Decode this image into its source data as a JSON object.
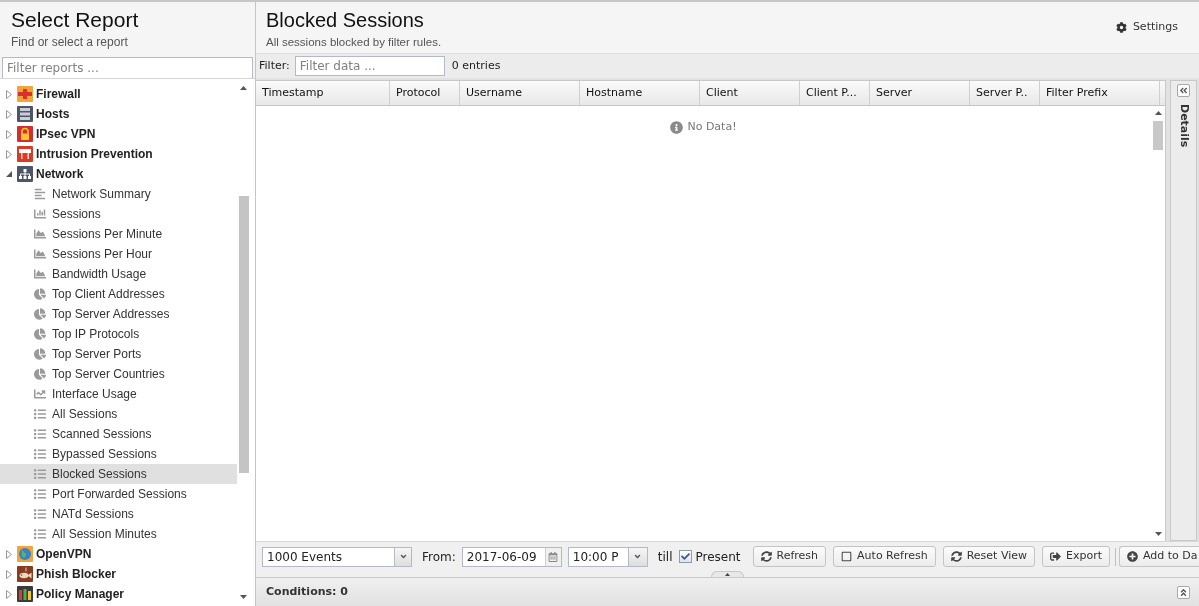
{
  "sidebar": {
    "title": "Select Report",
    "subtitle": "Find or select a report",
    "filter": {
      "placeholder": "Filter reports ..."
    },
    "tree": [
      {
        "label": "Firewall",
        "kind": "firewall",
        "expanded": false,
        "selected": false
      },
      {
        "label": "Hosts",
        "kind": "hosts",
        "expanded": false,
        "selected": false
      },
      {
        "label": "IPsec VPN",
        "kind": "ipsec",
        "expanded": false,
        "selected": false
      },
      {
        "label": "Intrusion Prevention",
        "kind": "ips",
        "expanded": false,
        "selected": false
      },
      {
        "label": "Network",
        "kind": "network",
        "expanded": true,
        "selected": false,
        "children": [
          {
            "label": "Network Summary",
            "kind": "summary",
            "selected": false
          },
          {
            "label": "Sessions",
            "kind": "bar",
            "selected": false
          },
          {
            "label": "Sessions Per Minute",
            "kind": "area",
            "selected": false
          },
          {
            "label": "Sessions Per Hour",
            "kind": "area",
            "selected": false
          },
          {
            "label": "Bandwidth Usage",
            "kind": "area",
            "selected": false
          },
          {
            "label": "Top Client Addresses",
            "kind": "pie",
            "selected": false
          },
          {
            "label": "Top Server Addresses",
            "kind": "pie",
            "selected": false
          },
          {
            "label": "Top IP Protocols",
            "kind": "pie",
            "selected": false
          },
          {
            "label": "Top Server Ports",
            "kind": "pie",
            "selected": false
          },
          {
            "label": "Top Server Countries",
            "kind": "pie",
            "selected": false
          },
          {
            "label": "Interface Usage",
            "kind": "line",
            "selected": false
          },
          {
            "label": "All Sessions",
            "kind": "list",
            "selected": false
          },
          {
            "label": "Scanned Sessions",
            "kind": "list",
            "selected": false
          },
          {
            "label": "Bypassed Sessions",
            "kind": "list",
            "selected": false
          },
          {
            "label": "Blocked Sessions",
            "kind": "list",
            "selected": true
          },
          {
            "label": "Port Forwarded Sessions",
            "kind": "list",
            "selected": false
          },
          {
            "label": "NATd Sessions",
            "kind": "list",
            "selected": false
          },
          {
            "label": "All Session Minutes",
            "kind": "list",
            "selected": false
          }
        ]
      },
      {
        "label": "OpenVPN",
        "kind": "openvpn",
        "expanded": false,
        "selected": false
      },
      {
        "label": "Phish Blocker",
        "kind": "phish",
        "expanded": false,
        "selected": false
      },
      {
        "label": "Policy Manager",
        "kind": "policy",
        "expanded": false,
        "selected": false
      }
    ]
  },
  "report": {
    "title": "Blocked Sessions",
    "subtitle": "All sessions blocked by filter rules.",
    "settings": "Settings",
    "filter": {
      "label": "Filter:",
      "placeholder": "Filter data ...",
      "count": "0 entries"
    },
    "table": {
      "columns": [
        "Timestamp",
        "Protocol",
        "Username",
        "Hostname",
        "Client",
        "Client P...",
        "Server",
        "Server P..",
        "Filter Prefix"
      ],
      "empty_message": "No Data!"
    },
    "details": {
      "label": "Details"
    },
    "toolbar": {
      "limit": "1000 Events",
      "from_label": "From:",
      "date": "2017-06-09",
      "time": "10:00 P",
      "till_label": "till",
      "present": {
        "label": "Present",
        "checked": true
      },
      "buttons": [
        {
          "label": "Refresh",
          "kind": "refresh",
          "on": false
        },
        {
          "label": "Auto Refresh",
          "kind": "toggle",
          "on": false
        },
        {
          "label": "Reset View",
          "kind": "refresh",
          "on": false
        },
        {
          "label": "Export",
          "kind": "export",
          "on": false
        },
        {
          "label": "Add to Da",
          "kind": "add",
          "on": false
        }
      ]
    },
    "conditions": {
      "label": "Conditions: 0"
    }
  }
}
